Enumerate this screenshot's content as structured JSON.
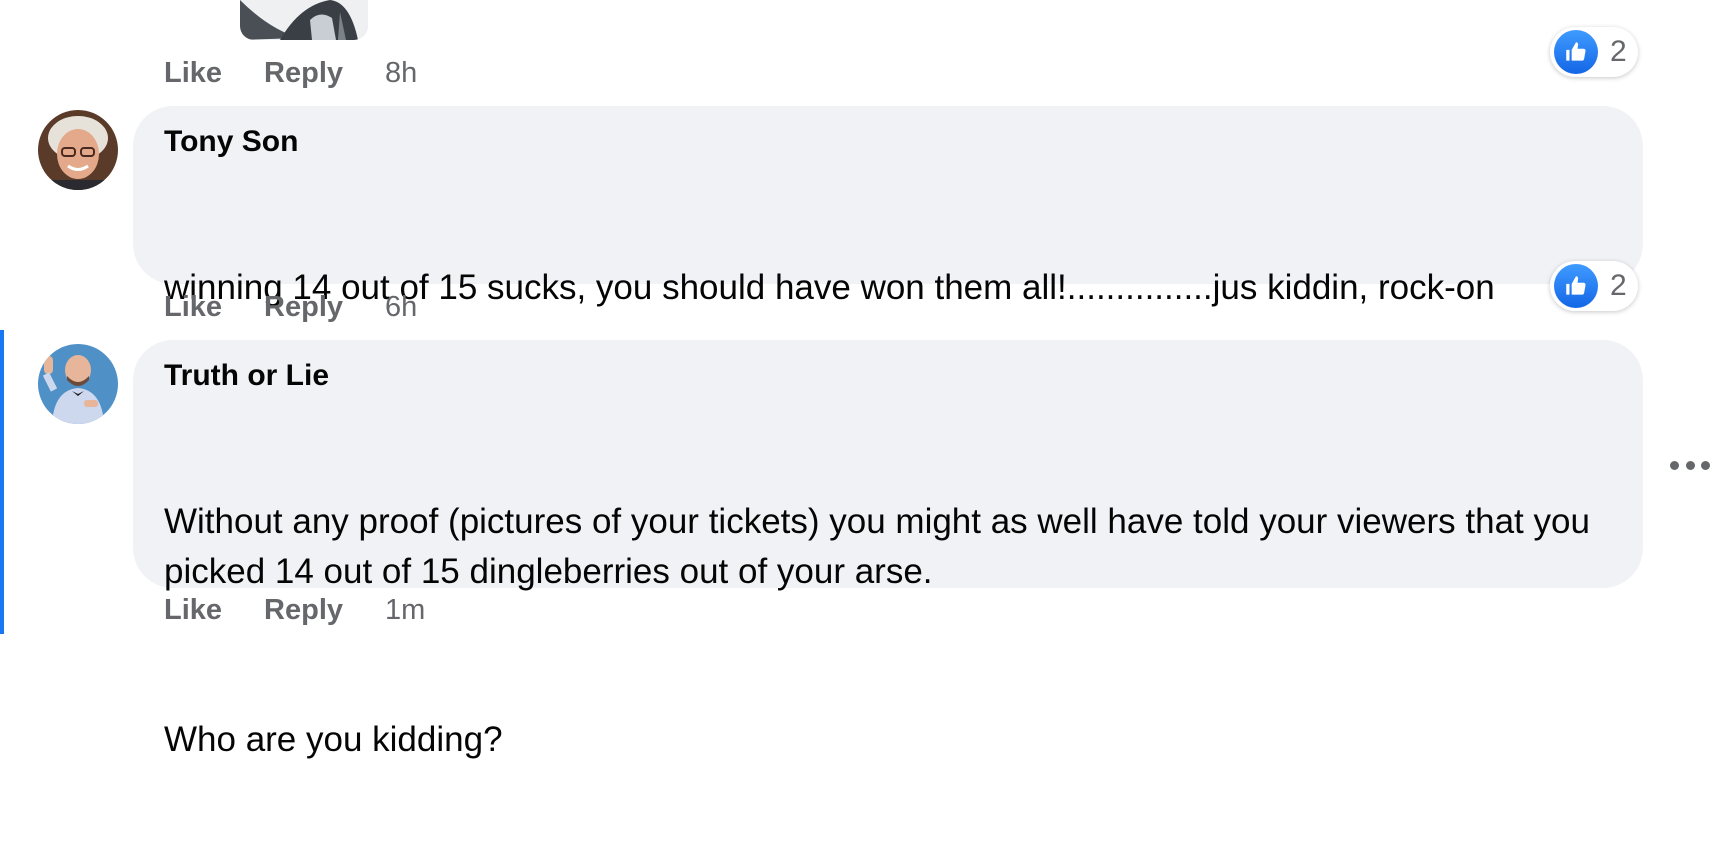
{
  "previous_comment": {
    "actions": {
      "like": "Like",
      "reply": "Reply",
      "time": "8h"
    },
    "reaction": {
      "icon": "thumbs-up-icon",
      "count": "2"
    }
  },
  "comments": [
    {
      "author": "Tony Son",
      "text": "winning 14 out of 15 sucks, you should have won them all!...............jus kiddin, rock-on",
      "actions": {
        "like": "Like",
        "reply": "Reply",
        "time": "6h"
      },
      "reaction": {
        "icon": "thumbs-up-icon",
        "count": "2"
      }
    },
    {
      "author": "Truth or Lie",
      "paragraphs": [
        "Without any proof (pictures of your tickets) you might as well have told your viewers that you picked 14 out of 15 dingleberries out of your arse.",
        "Who are you kidding?"
      ],
      "actions": {
        "like": "Like",
        "reply": "Reply",
        "time": "1m"
      }
    }
  ],
  "colors": {
    "bubble": "#f0f2f5",
    "secondary_text": "#65676b",
    "accent": "#1877f2"
  }
}
